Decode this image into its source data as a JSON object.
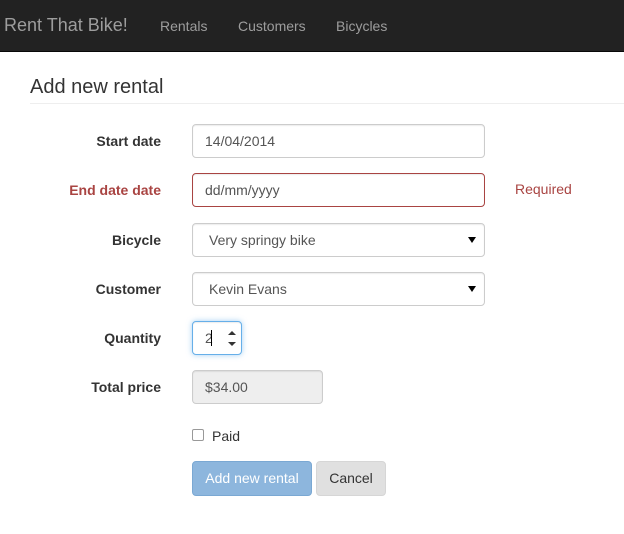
{
  "navbar": {
    "brand": "Rent That Bike!",
    "links": [
      "Rentals",
      "Customers",
      "Bicycles"
    ]
  },
  "page": {
    "title": "Add new rental"
  },
  "form": {
    "start_date": {
      "label": "Start date",
      "value": "14/04/2014"
    },
    "end_date": {
      "label": "End date date",
      "placeholder": "dd/mm/yyyy",
      "error": "Required"
    },
    "bicycle": {
      "label": "Bicycle",
      "selected": "Very springy bike"
    },
    "customer": {
      "label": "Customer",
      "selected": "Kevin Evans"
    },
    "quantity": {
      "label": "Quantity",
      "value": "2"
    },
    "total_price": {
      "label": "Total price",
      "value": "$34.00"
    },
    "paid": {
      "label": "Paid",
      "checked": false
    },
    "submit_label": "Add new rental",
    "cancel_label": "Cancel"
  },
  "colors": {
    "navbar": "#222222",
    "error": "#a94442",
    "primary_button": "#8db6dd",
    "focus": "#66afe9"
  }
}
